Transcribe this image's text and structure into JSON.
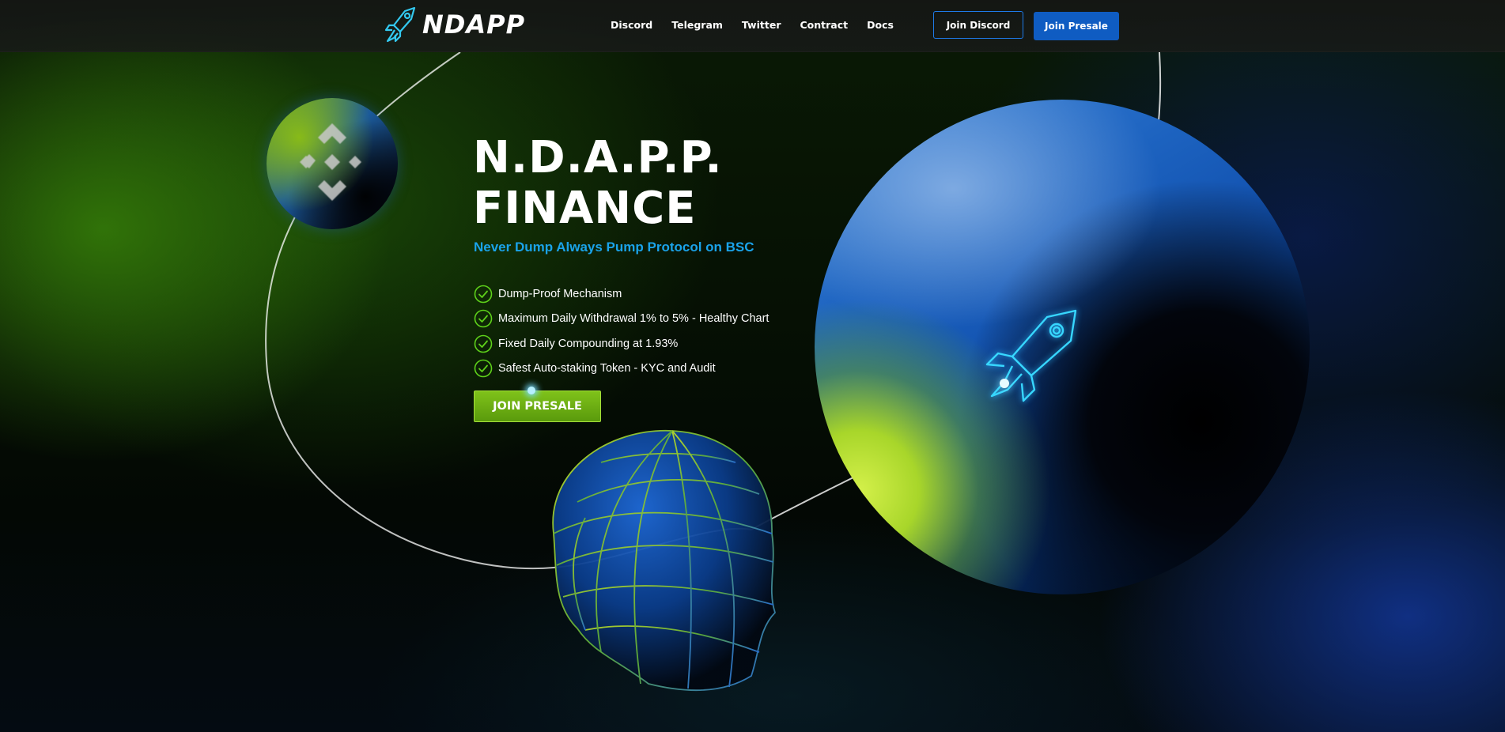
{
  "header": {
    "logo_text": "NDAPP",
    "nav": [
      {
        "label": "Discord"
      },
      {
        "label": "Telegram"
      },
      {
        "label": "Twitter"
      },
      {
        "label": "Contract"
      },
      {
        "label": "Docs"
      }
    ],
    "join_discord_label": "Join Discord",
    "join_presale_label": "Join Presale"
  },
  "hero": {
    "title_line1": "N.D.A.P.P.",
    "title_line2": "FINANCE",
    "subtitle": "Never Dump Always Pump Protocol on BSC",
    "features": [
      {
        "label": "Dump-Proof Mechanism"
      },
      {
        "label": "Maximum Daily Withdrawal 1% to 5% - Healthy Chart"
      },
      {
        "label": "Fixed Daily Compounding at 1.93%"
      },
      {
        "label": "Safest Auto-staking Token - KYC and Audit"
      }
    ],
    "cta_label": "JOIN PRESALE"
  },
  "colors": {
    "accent_green": "#7fc21a",
    "accent_blue": "#0f5cc2",
    "subtitle_blue": "#1aa3ea",
    "check_green": "#5ed11a"
  },
  "icons": [
    "rocket-logo-icon",
    "binance-icon",
    "check-icon",
    "rocket-icon",
    "wireframe-head-icon"
  ]
}
